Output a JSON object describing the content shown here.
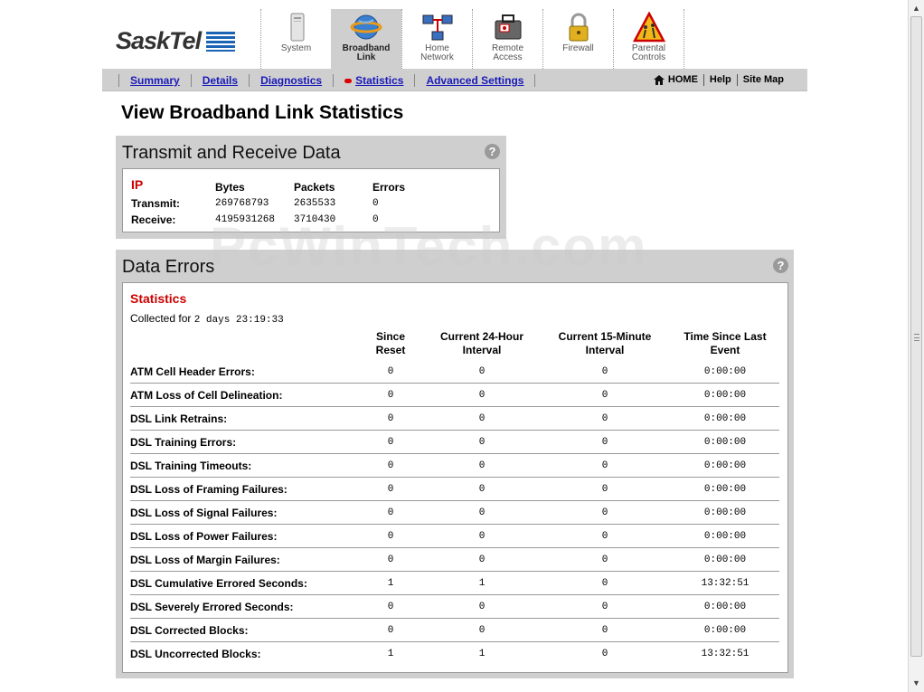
{
  "logo": {
    "text": "SaskTel"
  },
  "nav_icons": [
    {
      "label": [
        "System"
      ],
      "icon": "router-icon",
      "active": false
    },
    {
      "label": [
        "Broadband",
        "Link"
      ],
      "icon": "globe-icon",
      "active": true
    },
    {
      "label": [
        "Home",
        "Network"
      ],
      "icon": "network-icon",
      "active": false
    },
    {
      "label": [
        "Remote",
        "Access"
      ],
      "icon": "toolbox-icon",
      "active": false
    },
    {
      "label": [
        "Firewall"
      ],
      "icon": "lock-icon",
      "active": false
    },
    {
      "label": [
        "Parental",
        "Controls"
      ],
      "icon": "warning-sign-icon",
      "active": false
    }
  ],
  "subnav": {
    "links": [
      "Summary",
      "Details",
      "Diagnostics",
      "Statistics",
      "Advanced Settings"
    ],
    "active": "Statistics",
    "right": [
      "HOME",
      "Help",
      "Site Map"
    ]
  },
  "page_title": "View Broadband Link Statistics",
  "txrx": {
    "title": "Transmit and Receive Data",
    "help": "?",
    "section": "IP",
    "headers": [
      "Bytes",
      "Packets",
      "Errors"
    ],
    "rows": [
      {
        "label": "Transmit:",
        "bytes": "269768793",
        "packets": "2635533",
        "errors": "0"
      },
      {
        "label": "Receive:",
        "bytes": "4195931268",
        "packets": "3710430",
        "errors": "0"
      }
    ]
  },
  "data_errors": {
    "title": "Data Errors",
    "help": "?",
    "section": "Statistics",
    "collected_label": "Collected for",
    "collected_value": "2 days 23:19:33",
    "headers": [
      [
        "Since",
        "Reset"
      ],
      [
        "Current 24-Hour",
        "Interval"
      ],
      [
        "Current 15-Minute",
        "Interval"
      ],
      [
        "Time Since Last",
        "Event"
      ]
    ],
    "rows": [
      {
        "label": "ATM Cell Header Errors:",
        "values": [
          "0",
          "0",
          "0",
          "0:00:00"
        ]
      },
      {
        "label": "ATM Loss of Cell Delineation:",
        "values": [
          "0",
          "0",
          "0",
          "0:00:00"
        ]
      },
      {
        "label": "DSL Link Retrains:",
        "values": [
          "0",
          "0",
          "0",
          "0:00:00"
        ]
      },
      {
        "label": "DSL Training Errors:",
        "values": [
          "0",
          "0",
          "0",
          "0:00:00"
        ]
      },
      {
        "label": "DSL Training Timeouts:",
        "values": [
          "0",
          "0",
          "0",
          "0:00:00"
        ]
      },
      {
        "label": "DSL Loss of Framing Failures:",
        "values": [
          "0",
          "0",
          "0",
          "0:00:00"
        ]
      },
      {
        "label": "DSL Loss of Signal Failures:",
        "values": [
          "0",
          "0",
          "0",
          "0:00:00"
        ]
      },
      {
        "label": "DSL Loss of Power Failures:",
        "values": [
          "0",
          "0",
          "0",
          "0:00:00"
        ]
      },
      {
        "label": "DSL Loss of Margin Failures:",
        "values": [
          "0",
          "0",
          "0",
          "0:00:00"
        ]
      },
      {
        "label": "DSL Cumulative Errored Seconds:",
        "values": [
          "1",
          "1",
          "0",
          "13:32:51"
        ]
      },
      {
        "label": "DSL Severely Errored Seconds:",
        "values": [
          "0",
          "0",
          "0",
          "0:00:00"
        ]
      },
      {
        "label": "DSL Corrected Blocks:",
        "values": [
          "0",
          "0",
          "0",
          "0:00:00"
        ]
      },
      {
        "label": "DSL Uncorrected Blocks:",
        "values": [
          "1",
          "1",
          "0",
          "13:32:51"
        ]
      }
    ]
  },
  "watermark": "PcWinTech.com"
}
